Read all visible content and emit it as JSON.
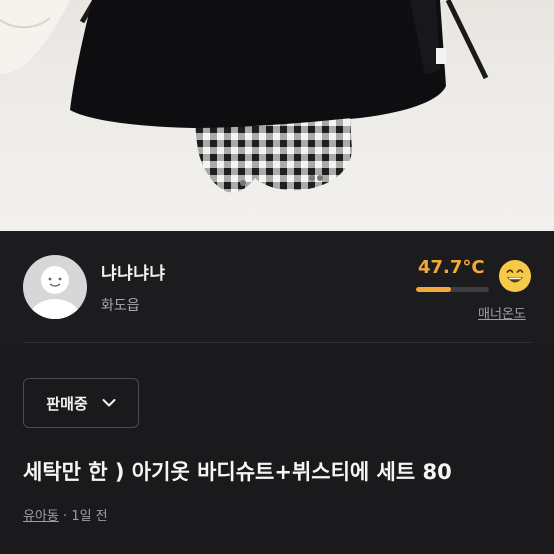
{
  "product": {
    "photo_alt": "product-photo",
    "title": "세탁만 한 ) 아기옷 바디슈트+뷔스티에 세트 80",
    "category": "유아동",
    "time_ago": "1일 전",
    "separator": "·"
  },
  "seller": {
    "nickname": "냐냐냐냐",
    "location": "화도읍",
    "manner_temp": "47.7°C",
    "manner_temp_value": 47.7,
    "manner_label": "매너온도",
    "temp_color": "#f2a93a"
  },
  "status": {
    "label": "판매중"
  }
}
